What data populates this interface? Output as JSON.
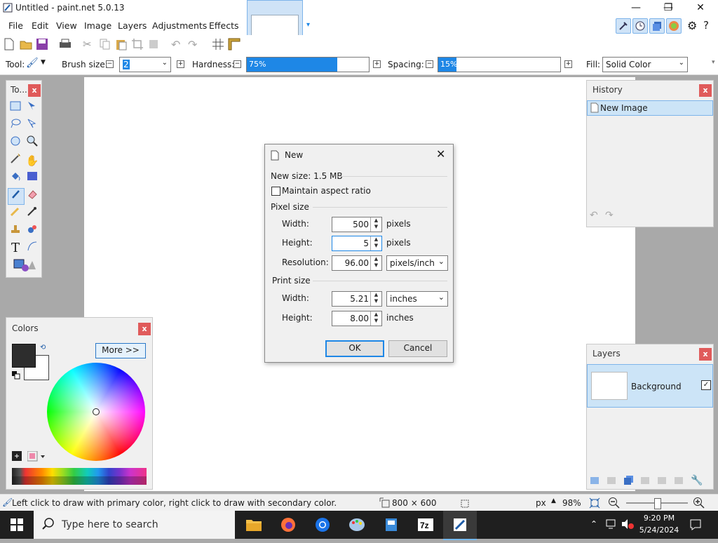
{
  "window": {
    "title": "Untitled - paint.net 5.0.13"
  },
  "menu": [
    "File",
    "Edit",
    "View",
    "Image",
    "Layers",
    "Adjustments",
    "Effects"
  ],
  "toolbar": {
    "tool_label": "Tool:",
    "brush_size_label": "Brush size:",
    "brush_size_value": "2",
    "hardness_label": "Hardness:",
    "hardness_value": "75%",
    "hardness_level": 0.75,
    "spacing_label": "Spacing:",
    "spacing_value": "15%",
    "spacing_level": 0.15,
    "fill_label": "Fill:",
    "fill_value": "Solid Color"
  },
  "tools_panel": {
    "title": "To..."
  },
  "colors_panel": {
    "title": "Colors",
    "more_button": "More >>"
  },
  "history_panel": {
    "title": "History",
    "items": [
      "New Image"
    ]
  },
  "layers_panel": {
    "title": "Layers",
    "items": [
      "Background"
    ]
  },
  "dialog": {
    "title": "New",
    "new_size": "New size: 1.5 MB",
    "maintain_aspect": "Maintain aspect ratio",
    "pixel_size_label": "Pixel size",
    "width_label": "Width:",
    "width_value": "500",
    "height_label": "Height:",
    "height_value": "5",
    "pixels_unit": "pixels",
    "resolution_label": "Resolution:",
    "resolution_value": "96.00",
    "resolution_unit": "pixels/inch",
    "print_size_label": "Print size",
    "print_width_label": "Width:",
    "print_width_value": "5.21",
    "print_width_unit": "inches",
    "print_height_label": "Height:",
    "print_height_value": "8.00",
    "print_height_unit": "inches",
    "ok": "OK",
    "cancel": "Cancel"
  },
  "statusbar": {
    "hint": "Left click to draw with primary color, right click to draw with secondary color.",
    "image_size": "800 × 600",
    "unit": "px",
    "zoom": "98%"
  },
  "taskbar": {
    "search_placeholder": "Type here to search",
    "time": "9:20 PM",
    "date": "5/24/2024"
  },
  "colors": {
    "accent": "#1e87e6",
    "selection": "#cce4f7"
  }
}
